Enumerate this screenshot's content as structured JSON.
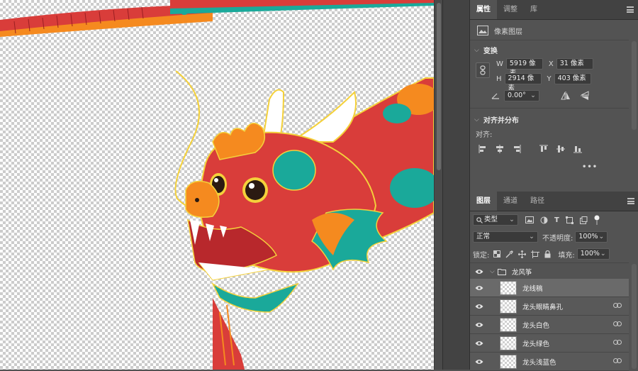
{
  "canvas": {
    "art_label": "dragon-kite-artwork"
  },
  "properties_panel": {
    "tabs": [
      {
        "label": "属性",
        "active": true
      },
      {
        "label": "调整",
        "active": false
      },
      {
        "label": "库",
        "active": false
      }
    ],
    "layer_type": "像素图层",
    "transform": {
      "title": "变换",
      "w_label": "W",
      "w_value": "5919 像素",
      "h_label": "H",
      "h_value": "2914 像素",
      "x_label": "X",
      "x_value": "31 像素",
      "y_label": "Y",
      "y_value": "403 像素",
      "angle_value": "0.00°"
    },
    "align": {
      "title": "对齐并分布",
      "label": "对齐:",
      "more": "•••"
    }
  },
  "layers_panel": {
    "tabs": [
      {
        "label": "图层",
        "active": true
      },
      {
        "label": "通道",
        "active": false
      },
      {
        "label": "路径",
        "active": false
      }
    ],
    "filter_kind": "类型",
    "blend_mode": "正常",
    "opacity_label": "不透明度:",
    "opacity_value": "100%",
    "lock_label": "锁定:",
    "fill_label": "填充:",
    "fill_value": "100%",
    "group_name": "龙风筝",
    "layers": [
      {
        "name": "龙线稿",
        "linked": false,
        "selected": true
      },
      {
        "name": "龙头眼睛鼻孔",
        "linked": true,
        "selected": false
      },
      {
        "name": "龙头白色",
        "linked": true,
        "selected": false
      },
      {
        "name": "龙头绿色",
        "linked": true,
        "selected": false
      },
      {
        "name": "龙头浅蓝色",
        "linked": true,
        "selected": false
      }
    ]
  },
  "colors": {
    "red": "#d93d3a",
    "orange": "#f58a1f",
    "teal": "#1aa99a",
    "yellow": "#f4d13b",
    "dark_red": "#b8282c"
  }
}
